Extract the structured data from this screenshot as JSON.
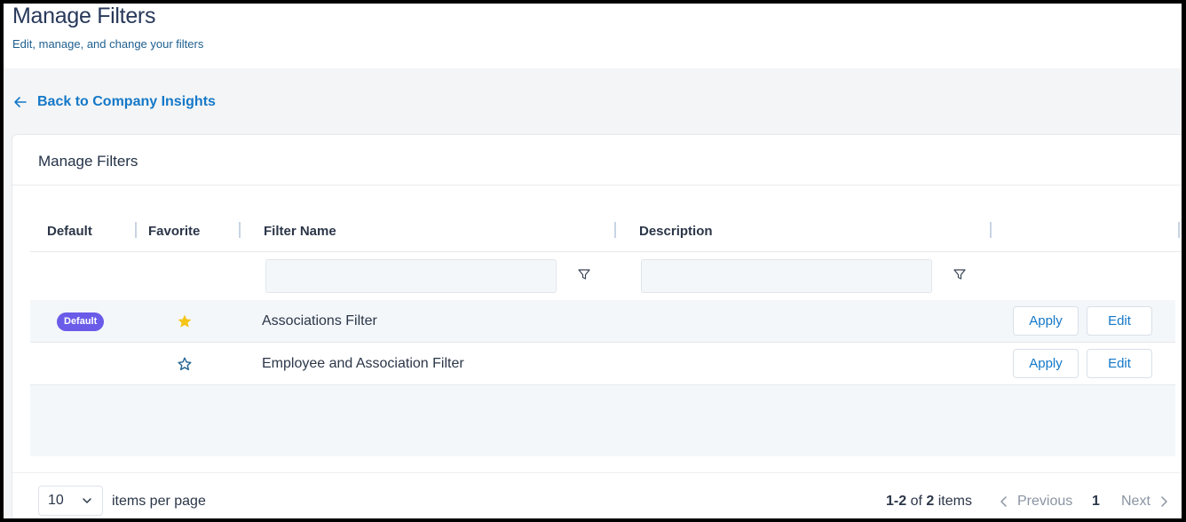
{
  "header": {
    "title": "Manage Filters",
    "subtitle": "Edit, manage, and change your filters"
  },
  "back_link": {
    "label": "Back to Company Insights"
  },
  "card": {
    "title": "Manage Filters"
  },
  "table": {
    "columns": [
      "Default",
      "Favorite",
      "Filter Name",
      "Description"
    ],
    "filters": {
      "filter_name_value": "",
      "description_value": ""
    },
    "rows": [
      {
        "default_badge": "Default",
        "favorite": true,
        "favorite_icon": "star-filled-icon",
        "name": "Associations Filter",
        "description": "",
        "apply_label": "Apply",
        "edit_label": "Edit"
      },
      {
        "default_badge": "",
        "favorite": false,
        "favorite_icon": "star-outline-icon",
        "name": "Employee and Association Filter",
        "description": "",
        "apply_label": "Apply",
        "edit_label": "Edit"
      }
    ]
  },
  "pager": {
    "page_size": "10",
    "items_per_page_label": "items per page",
    "range": "1-2",
    "of_label": "of",
    "total": "2",
    "items_label": "items",
    "previous_label": "Previous",
    "current_page": "1",
    "next_label": "Next"
  },
  "colors": {
    "accent": "#1478c8",
    "badge": "#6a5ce8",
    "star": "#f5c518",
    "title": "#27385a"
  }
}
